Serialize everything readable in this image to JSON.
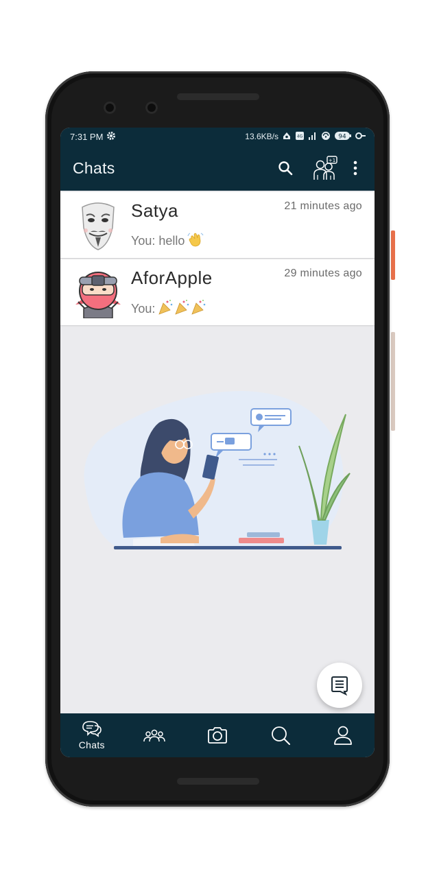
{
  "status_bar": {
    "time": "7:31 PM",
    "net_speed": "13.6KB/s",
    "battery": "94",
    "icons": [
      "gear-icon",
      "sync-icon",
      "volte-icon",
      "signal-icon",
      "wifi-icon",
      "battery-icon",
      "key-icon"
    ]
  },
  "app_bar": {
    "title": "Chats",
    "actions": [
      "search-icon",
      "contacts-badge-icon",
      "more-vert-icon"
    ]
  },
  "chats": [
    {
      "name": "Satya",
      "time": "21 minutes ago",
      "preview": "You: hello",
      "emoji": "waving-hand-emoji",
      "avatar": "mask-avatar"
    },
    {
      "name": "AforApple",
      "time": "29 minutes ago",
      "preview": "You:",
      "emoji": "party-popper-emoji x3",
      "avatar": "ninja-avatar"
    }
  ],
  "fab": {
    "icon": "new-message-icon"
  },
  "bottom_nav": [
    {
      "id": "chats",
      "label": "Chats",
      "icon": "chat-bubbles-icon",
      "active": true
    },
    {
      "id": "groups",
      "label": "",
      "icon": "group-icon",
      "active": false
    },
    {
      "id": "camera",
      "label": "",
      "icon": "camera-icon",
      "active": false
    },
    {
      "id": "search",
      "label": "",
      "icon": "search-icon",
      "active": false
    },
    {
      "id": "profile",
      "label": "",
      "icon": "person-icon",
      "active": false
    }
  ],
  "colors": {
    "primary_dark": "#0c2c3a",
    "background": "#ebebee",
    "card": "#ffffff",
    "accent_illustration": "#7aa0de"
  }
}
